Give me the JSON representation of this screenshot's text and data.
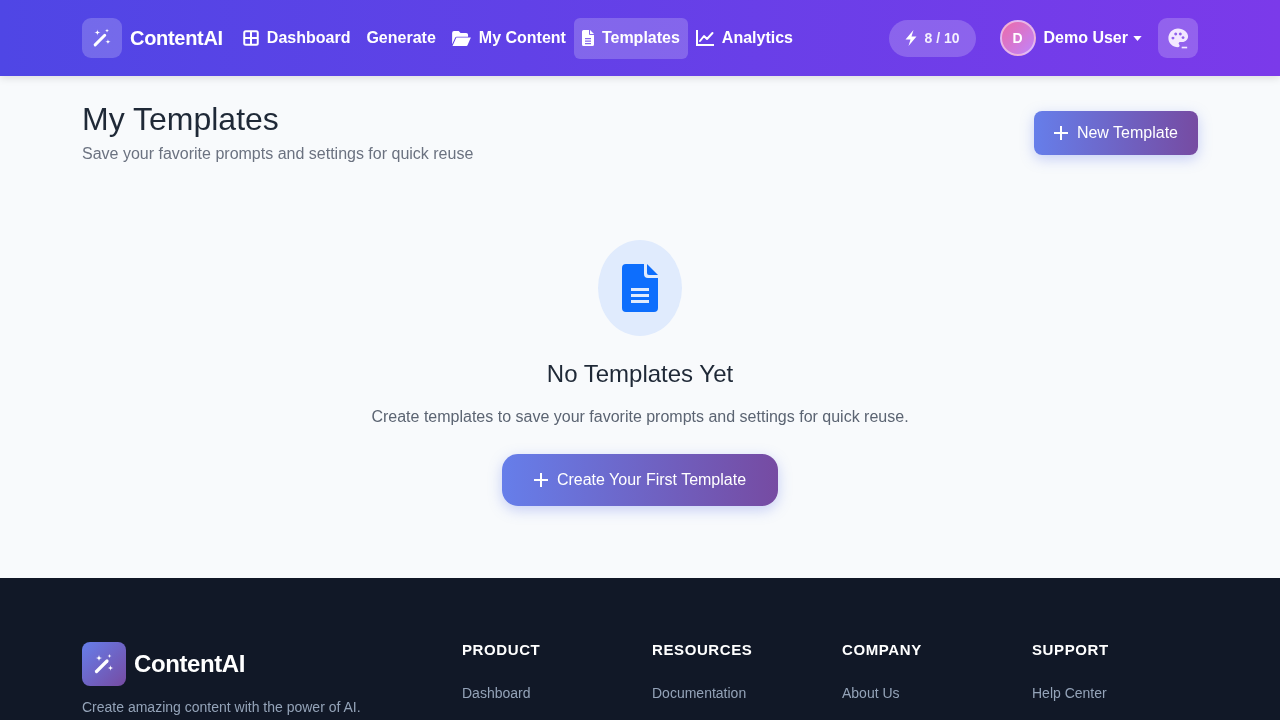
{
  "header": {
    "brand": "ContentAI",
    "nav": [
      {
        "label": "Dashboard",
        "selected": false
      },
      {
        "label": "Generate",
        "selected": false
      },
      {
        "label": "My Content",
        "selected": false
      },
      {
        "label": "Templates",
        "selected": true
      },
      {
        "label": "Analytics",
        "selected": false
      }
    ],
    "credits": "8 / 10",
    "user": {
      "initial": "D",
      "name": "Demo User"
    }
  },
  "page": {
    "title": "My Templates",
    "subtitle": "Save your favorite prompts and settings for quick reuse",
    "new_button": "New Template"
  },
  "empty_state": {
    "title": "No Templates Yet",
    "text": "Create templates to save your favorite prompts and settings for quick reuse.",
    "button": "Create Your First Template"
  },
  "footer": {
    "brand": "ContentAI",
    "tagline": "Create amazing content with the power of AI.",
    "columns": [
      {
        "heading": "PRODUCT",
        "links": [
          "Dashboard"
        ]
      },
      {
        "heading": "RESOURCES",
        "links": [
          "Documentation"
        ]
      },
      {
        "heading": "COMPANY",
        "links": [
          "About Us"
        ]
      },
      {
        "heading": "SUPPORT",
        "links": [
          "Help Center"
        ]
      }
    ]
  }
}
